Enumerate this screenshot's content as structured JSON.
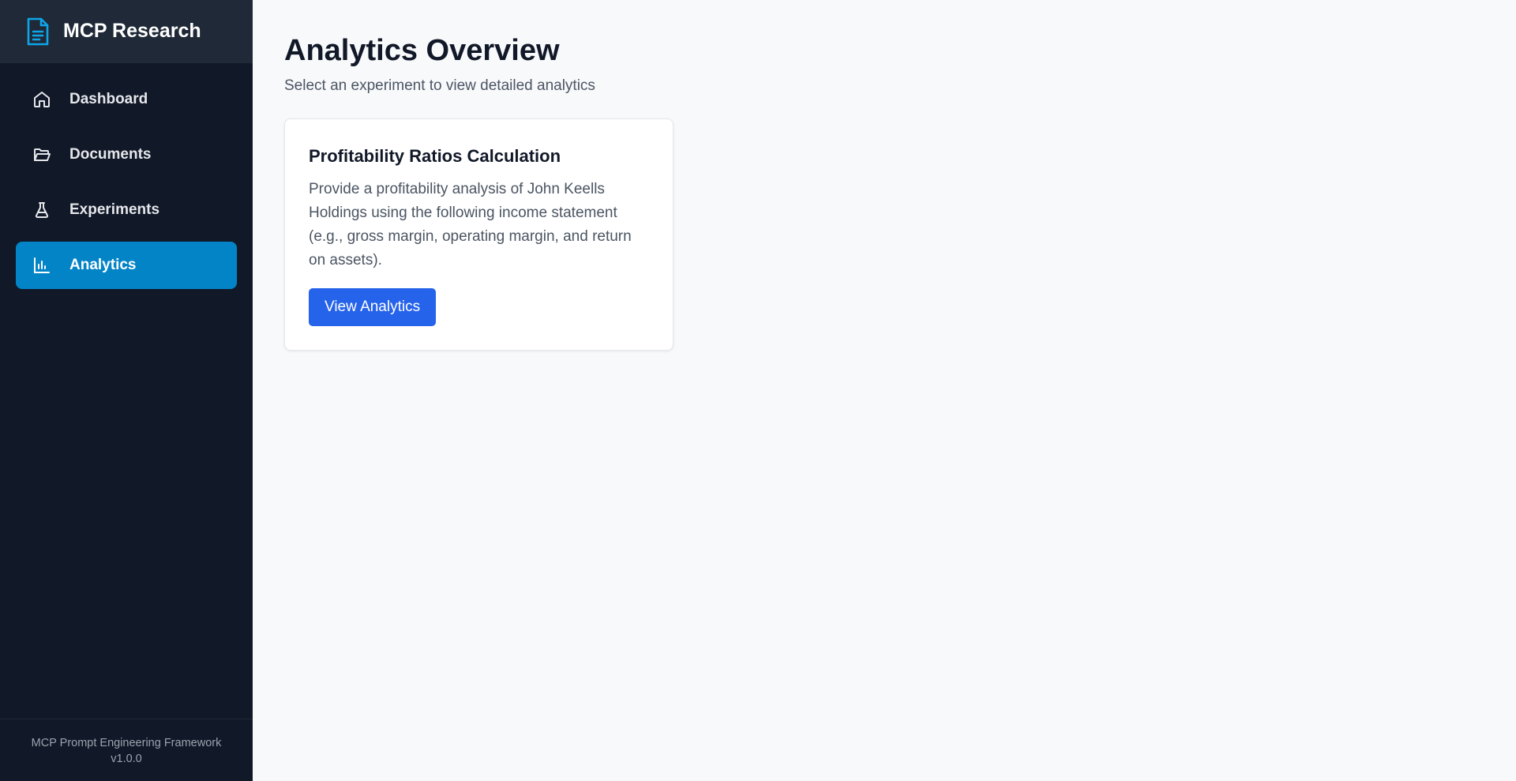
{
  "brand": {
    "title": "MCP Research",
    "icon": "document-icon",
    "accent": "#0ea5e9"
  },
  "nav": {
    "items": [
      {
        "label": "Dashboard",
        "icon": "home-icon",
        "active": false
      },
      {
        "label": "Documents",
        "icon": "folder-open-icon",
        "active": false
      },
      {
        "label": "Experiments",
        "icon": "flask-icon",
        "active": false
      },
      {
        "label": "Analytics",
        "icon": "bar-chart-icon",
        "active": true
      }
    ]
  },
  "footer": {
    "line1": "MCP Prompt Engineering Framework",
    "version": "v1.0.0"
  },
  "main": {
    "title": "Analytics Overview",
    "subtitle": "Select an experiment to view detailed analytics",
    "cards": [
      {
        "title": "Profitability Ratios Calculation",
        "description": "Provide a profitability analysis of John Keells Holdings using the following income statement (e.g., gross margin, operating margin, and return on assets).",
        "button_label": "View Analytics"
      }
    ]
  },
  "colors": {
    "sidebar_bg": "#111827",
    "active_nav": "#0284c7",
    "primary_button": "#2563eb",
    "page_bg": "#f8f9fb"
  }
}
